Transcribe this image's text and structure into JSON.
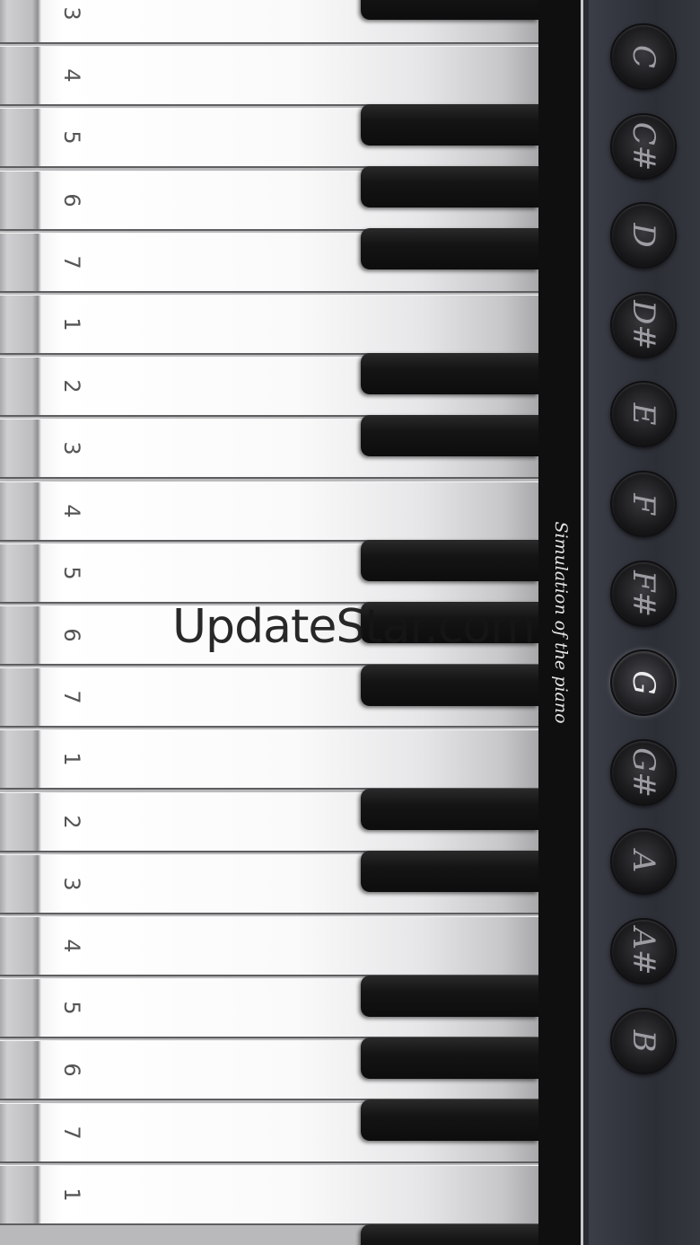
{
  "keyboard": {
    "white_keys": [
      "3",
      "4",
      "5",
      "6",
      "7",
      "1",
      "2",
      "3",
      "4",
      "5",
      "6",
      "7",
      "1",
      "2",
      "3",
      "4",
      "5",
      "6",
      "7",
      "1"
    ],
    "black_key_count": 14
  },
  "side_strip": {
    "tagline": "Simulation of the piano"
  },
  "note_panel": {
    "buttons": [
      "C",
      "C#",
      "D",
      "D#",
      "E",
      "F",
      "F#",
      "G",
      "G#",
      "A",
      "A#",
      "B"
    ],
    "selected": "G"
  },
  "watermark": {
    "text": "UpdateStar.com"
  }
}
